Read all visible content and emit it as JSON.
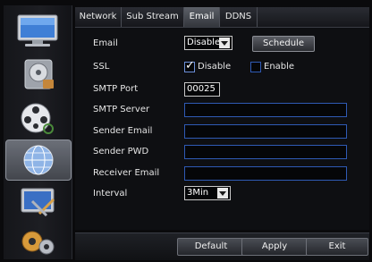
{
  "tabs": [
    {
      "label": "Network"
    },
    {
      "label": "Sub Stream"
    },
    {
      "label": "Email"
    },
    {
      "label": "DDNS"
    }
  ],
  "active_tab": "Email",
  "sidebar": {
    "items": [
      {
        "icon": "monitor-icon"
      },
      {
        "icon": "disk-icon"
      },
      {
        "icon": "camera-reel-icon"
      },
      {
        "icon": "globe-network-icon"
      },
      {
        "icon": "screen-tools-icon"
      },
      {
        "icon": "gears-icon"
      }
    ],
    "active_index": 3
  },
  "form": {
    "email_label": "Email",
    "email_value": "Disable",
    "schedule_label": "Schedule",
    "ssl_label": "SSL",
    "ssl_disable_label": "Disable",
    "ssl_enable_label": "Enable",
    "ssl_disable_checked": true,
    "ssl_enable_checked": false,
    "smtp_port_label": "SMTP Port",
    "smtp_port_value": "00025",
    "smtp_server_label": "SMTP Server",
    "smtp_server_value": "",
    "sender_email_label": "Sender Email",
    "sender_email_value": "",
    "sender_pwd_label": "Sender PWD",
    "sender_pwd_value": "",
    "receiver_email_label": "Receiver Email",
    "receiver_email_value": "",
    "interval_label": "Interval",
    "interval_value": "3Min"
  },
  "buttons": {
    "default": "Default",
    "apply": "Apply",
    "exit": "Exit"
  },
  "colors": {
    "field_border": "#2f5ab4",
    "active_tab": "#5c6068"
  }
}
